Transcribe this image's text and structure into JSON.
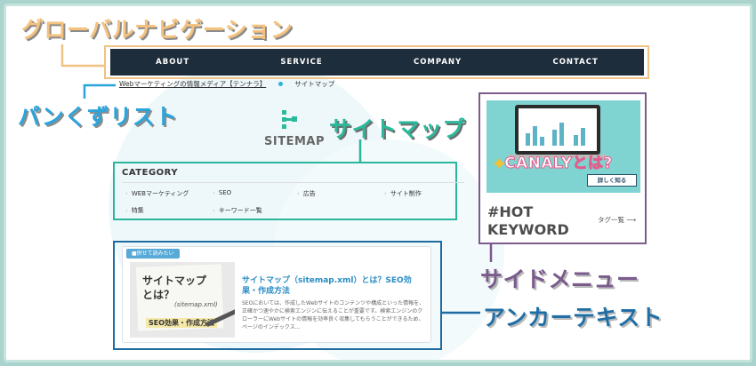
{
  "callouts": {
    "global_nav": "グローバルナビゲーション",
    "breadcrumb": "パンくずリスト",
    "sitemap": "サイトマップ",
    "side_menu": "サイドメニュー",
    "anchor_text": "アンカーテキスト"
  },
  "nav": {
    "items": [
      "ABOUT",
      "SERVICE",
      "COMPANY",
      "CONTACT"
    ]
  },
  "breadcrumb": {
    "home": "Webマーケティングの情報メディア【テンナラ】",
    "current": "サイトマップ"
  },
  "sitemap": {
    "title": "SITEMAP"
  },
  "category": {
    "heading": "CATEGORY",
    "items": [
      "WEBマーケティング",
      "SEO",
      "広告",
      "サイト制作",
      "特集",
      "キーワード一覧"
    ]
  },
  "side": {
    "ad_title": "CANALYとは?",
    "ad_button": "詳しく知る",
    "hot_line1": "#HOT",
    "hot_line2": "KEYWORD",
    "tag_link": "タグ一覧 ⟶"
  },
  "article": {
    "badge": "■併せて読みたい",
    "thumb_line1": "サイトマップ",
    "thumb_line2": "とは？",
    "thumb_line3": "(sitemap.xml)",
    "thumb_label": "SEO効果・作成方法",
    "title": "サイトマップ（sitemap.xml）とは？SEO効果・作成方法",
    "body": "SEOにおいては、作成したWebサイトのコンテンツや構成といった情報を、正確かつ速やかに検索エンジンに伝えることが重要です。検索エンジンのクローラーにWebサイトの情報を効率良く収集してもらうことができるため、ページのインデックス…"
  },
  "colors": {
    "nav_bg": "#1e2d3b",
    "orange": "#f4c27e",
    "blue": "#2aa5dc",
    "green": "#2ab99a",
    "purple": "#7a5b8c",
    "navy": "#1f6fa6",
    "page_bg": "#a9d3cc"
  }
}
